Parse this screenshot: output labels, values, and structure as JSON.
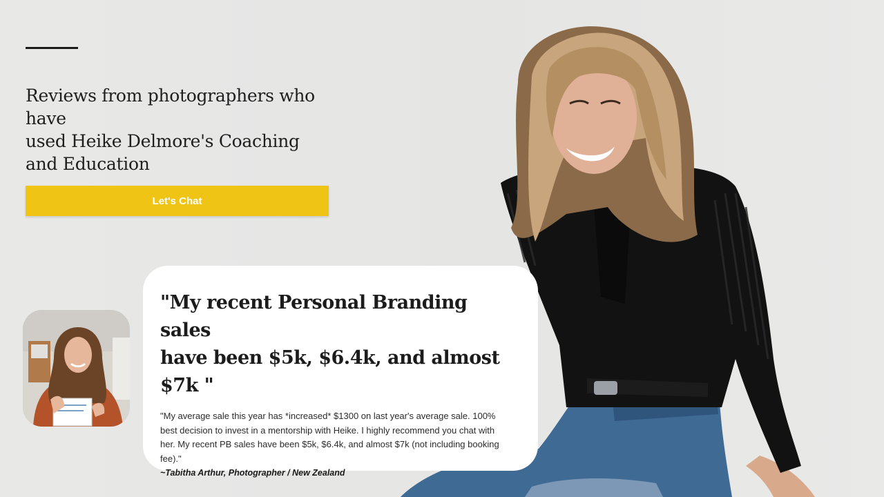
{
  "header": {
    "heading_lines": [
      "Reviews from photographers who have",
      "used Heike Delmore's Coaching",
      "and Education"
    ],
    "cta_label": "Let's Chat"
  },
  "review": {
    "headline_lines": [
      "\"My recent Personal Branding sales",
      "have been $5k, $6.4k, and almost",
      "$7k \""
    ],
    "body": "\"My average sale this year has *increased* $1300 on last year's average sale. 100% best decision to invest in a mentorship with Heike. I highly recommend you chat with her. My recent PB sales have been $5k, $6.4k, and almost $7k (not including booking fee).\"",
    "author": "~Tabitha Arthur, Photographer / New Zealand"
  },
  "colors": {
    "accent": "#f0c414",
    "background": "#e6e6e5",
    "card": "#ffffff"
  }
}
